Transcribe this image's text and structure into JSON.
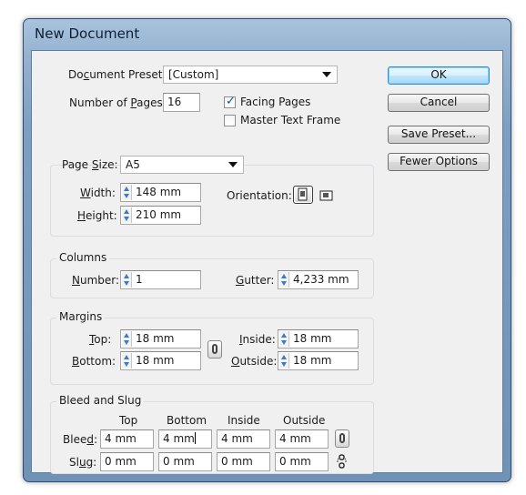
{
  "window": {
    "title": "New Document"
  },
  "preset": {
    "label_pre": "Do",
    "label_u": "c",
    "label_post": "ument Preset:",
    "value": "[Custom]"
  },
  "pages": {
    "label_pre": "Number of ",
    "label_u": "P",
    "label_post": "ages:",
    "value": "16"
  },
  "facing_pages": {
    "label": "Facing Pages",
    "checked": true
  },
  "master_text_frame": {
    "label": "Master Text Frame",
    "checked": false
  },
  "page_size": {
    "label_pre": "Page ",
    "label_u": "S",
    "label_post": "ize:",
    "value": "A5",
    "width_label_u": "W",
    "width_label_post": "idth:",
    "width": "148 mm",
    "height_label_u": "H",
    "height_label_post": "eight:",
    "height": "210 mm",
    "orientation_label": "Orientation:"
  },
  "columns": {
    "title": "Columns",
    "number_label_u": "N",
    "number_label_post": "umber:",
    "number": "1",
    "gutter_label_u": "G",
    "gutter_label_post": "utter:",
    "gutter": "4,233 mm"
  },
  "margins": {
    "title": "Margins",
    "top_label_u": "T",
    "top_label_post": "op:",
    "top": "18 mm",
    "bottom_label_u": "B",
    "bottom_label_post": "ottom:",
    "bottom": "18 mm",
    "inside_label_u": "I",
    "inside_label_post": "nside:",
    "inside": "18 mm",
    "outside_label_u": "O",
    "outside_label_post": "utside:",
    "outside": "18 mm"
  },
  "bleed_slug": {
    "title": "Bleed and Slug",
    "headers": [
      "Top",
      "Bottom",
      "Inside",
      "Outside"
    ],
    "bleed_label_pre": "Blee",
    "bleed_label_u": "d",
    "bleed_label_post": ":",
    "bleed": [
      "4 mm",
      "4 mm",
      "4 mm",
      "4 mm"
    ],
    "slug_label_pre": "Sl",
    "slug_label_u": "u",
    "slug_label_post": "g:",
    "slug": [
      "0 mm",
      "0 mm",
      "0 mm",
      "0 mm"
    ]
  },
  "buttons": {
    "ok": "OK",
    "cancel": "Cancel",
    "save_preset": "Save Preset...",
    "fewer_options": "Fewer Options"
  },
  "icons": {
    "portrait": "portrait-orientation-icon",
    "landscape": "landscape-orientation-icon",
    "chain": "chain-link-icon",
    "chain_broken": "broken-chain-icon"
  }
}
